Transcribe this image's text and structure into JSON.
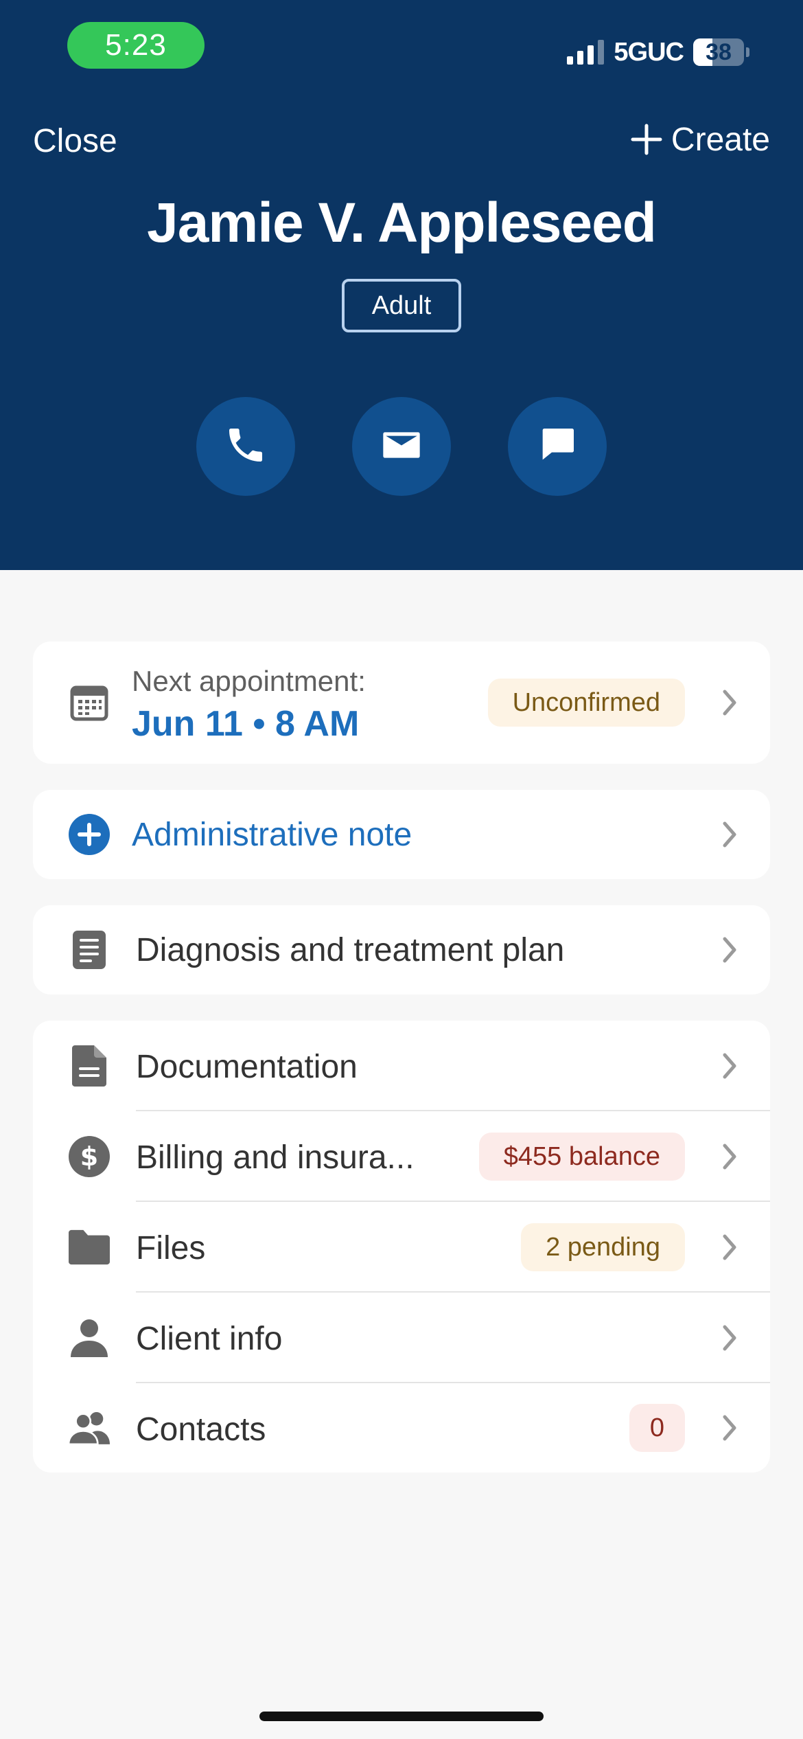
{
  "status_bar": {
    "time": "5:23",
    "network": "5GUC",
    "battery": "38",
    "battery_level": 0.38
  },
  "header": {
    "close_label": "Close",
    "create_label": "Create",
    "client_name": "Jamie V. Appleseed",
    "age_badge": "Adult",
    "actions": [
      "phone-icon",
      "email-icon",
      "message-icon"
    ]
  },
  "appointment": {
    "label": "Next appointment:",
    "date": "Jun 11 • 8 AM",
    "status": "Unconfirmed"
  },
  "admin_note": {
    "label": "Administrative note"
  },
  "diagnosis": {
    "label": "Diagnosis and treatment plan"
  },
  "menu": {
    "documentation": {
      "label": "Documentation"
    },
    "billing": {
      "label": "Billing and insura...",
      "badge": "$455 balance"
    },
    "files": {
      "label": "Files",
      "badge": "2 pending"
    },
    "client_info": {
      "label": "Client info"
    },
    "contacts": {
      "label": "Contacts",
      "badge": "0"
    }
  },
  "colors": {
    "header_bg": "#0b3563",
    "accent": "#1d6ebc",
    "warn_bg": "#fdf3e4",
    "bad_bg": "#fcebe9"
  }
}
